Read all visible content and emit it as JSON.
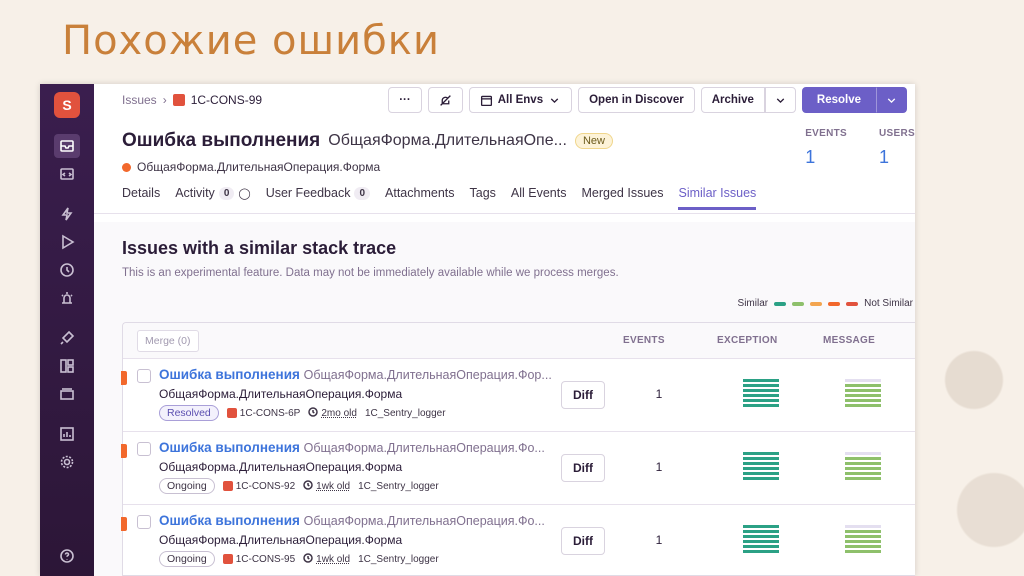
{
  "slide_title": "Похожие ошибки",
  "sidebar": {
    "logo": "S",
    "icons": [
      "issues-icon",
      "projects-icon",
      "performance-icon",
      "replays-icon",
      "releases-icon",
      "alerts-icon",
      "discover-icon",
      "dashboards-icon",
      "archive-icon",
      "stats-icon",
      "settings-icon"
    ],
    "help": "?"
  },
  "breadcrumb": {
    "root": "Issues",
    "current": "1C-CONS-99"
  },
  "toolbar": {
    "more": "···",
    "envs": "All Envs",
    "open_discover": "Open in Discover",
    "archive": "Archive",
    "resolve": "Resolve"
  },
  "issue": {
    "title": "Ошибка выполнения",
    "subtitle": "ОбщаяФорма.ДлительнаяОпе...",
    "badge": "New",
    "culprit": "ОбщаяФорма.ДлительнаяОперация.Форма",
    "events_label": "EVENTS",
    "events_value": "1",
    "users_label": "USERS",
    "users_value": "1"
  },
  "tabs": [
    {
      "label": "Details"
    },
    {
      "label": "Activity",
      "count": "0"
    },
    {
      "label": "User Feedback",
      "count": "0"
    },
    {
      "label": "Attachments"
    },
    {
      "label": "Tags"
    },
    {
      "label": "All Events"
    },
    {
      "label": "Merged Issues"
    },
    {
      "label": "Similar Issues",
      "active": true
    }
  ],
  "similar": {
    "title": "Issues with a similar stack trace",
    "description": "This is an experimental feature. Data may not be immediately available while we process merges.",
    "legend_left": "Similar",
    "legend_right": "Not Similar",
    "legend_colors": [
      "#2ba185",
      "#8ec06b",
      "#f3a54f",
      "#f2682c",
      "#e1523d"
    ],
    "merge_label": "Merge (0)",
    "col_events": "EVENTS",
    "col_exception": "EXCEPTION",
    "col_message": "MESSAGE",
    "diff_label": "Diff",
    "rows": [
      {
        "title": "Ошибка выполнения",
        "rest": "ОбщаяФорма.ДлительнаяОперация.Фор...",
        "sub": "ОбщаяФорма.ДлительнаяОперация.Форма",
        "status": "Resolved",
        "short_id": "1C-CONS-6P",
        "age": "2mo old",
        "logger": "1C_Sentry_logger",
        "events": "1"
      },
      {
        "title": "Ошибка выполнения",
        "rest": "ОбщаяФорма.ДлительнаяОперация.Фо...",
        "sub": "ОбщаяФорма.ДлительнаяОперация.Форма",
        "status": "Ongoing",
        "short_id": "1C-CONS-92",
        "age": "1wk old",
        "logger": "1C_Sentry_logger",
        "events": "1"
      },
      {
        "title": "Ошибка выполнения",
        "rest": "ОбщаяФорма.ДлительнаяОперация.Фо...",
        "sub": "ОбщаяФорма.ДлительнаяОперация.Форма",
        "status": "Ongoing",
        "short_id": "1C-CONS-95",
        "age": "1wk old",
        "logger": "1C_Sentry_logger",
        "events": "1"
      }
    ]
  }
}
